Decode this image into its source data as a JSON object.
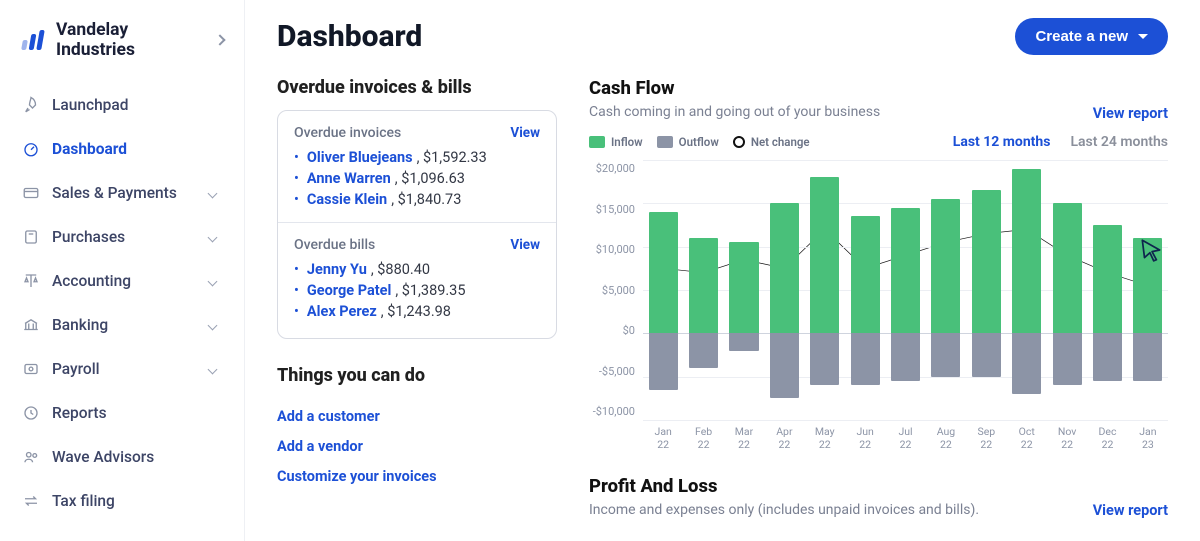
{
  "brand": {
    "name": "Vandelay Industries"
  },
  "sidebar": {
    "items": [
      {
        "icon": "rocket-icon",
        "label": "Launchpad",
        "active": false,
        "expandable": false
      },
      {
        "icon": "gauge-icon",
        "label": "Dashboard",
        "active": true,
        "expandable": false
      },
      {
        "icon": "card-icon",
        "label": "Sales & Payments",
        "active": false,
        "expandable": true
      },
      {
        "icon": "cart-icon",
        "label": "Purchases",
        "active": false,
        "expandable": true
      },
      {
        "icon": "scales-icon",
        "label": "Accounting",
        "active": false,
        "expandable": true
      },
      {
        "icon": "bank-icon",
        "label": "Banking",
        "active": false,
        "expandable": true
      },
      {
        "icon": "money-icon",
        "label": "Payroll",
        "active": false,
        "expandable": true
      },
      {
        "icon": "clock-icon",
        "label": "Reports",
        "active": false,
        "expandable": false
      },
      {
        "icon": "people-icon",
        "label": "Wave Advisors",
        "active": false,
        "expandable": false
      },
      {
        "icon": "arrows-icon",
        "label": "Tax filing",
        "active": false,
        "expandable": false
      }
    ]
  },
  "header": {
    "title": "Dashboard",
    "create_label": "Create a new"
  },
  "overdue": {
    "section_title": "Overdue invoices & bills",
    "invoices_heading": "Overdue invoices",
    "bills_heading": "Overdue bills",
    "view_label": "View",
    "invoices": [
      {
        "name": "Oliver Bluejeans",
        "amount": "$1,592.33"
      },
      {
        "name": "Anne Warren",
        "amount": "$1,096.63"
      },
      {
        "name": "Cassie Klein",
        "amount": "$1,840.73"
      }
    ],
    "bills": [
      {
        "name": "Jenny Yu",
        "amount": "$880.40"
      },
      {
        "name": "George Patel",
        "amount": "$1,389.35"
      },
      {
        "name": "Alex Perez",
        "amount": "$1,243.98"
      }
    ]
  },
  "things": {
    "title": "Things you can do",
    "links": [
      "Add a customer",
      "Add a vendor",
      "Customize your invoices"
    ]
  },
  "cashflow": {
    "title": "Cash Flow",
    "subtitle": "Cash coming in and going out of your business",
    "view_report": "View report",
    "legend": {
      "inflow": "Inflow",
      "outflow": "Outflow",
      "net": "Net change"
    },
    "range_active": "Last 12 months",
    "range_other": "Last 24 months"
  },
  "y_ticks": [
    "$20,000",
    "$15,000",
    "$10,000",
    "$5,000",
    "$0",
    "-$5,000",
    "-$10,000"
  ],
  "chart_data": {
    "type": "bar",
    "categories": [
      "Jan 22",
      "Feb 22",
      "Mar 22",
      "Apr 22",
      "May 22",
      "Jun 22",
      "Jul 22",
      "Aug 22",
      "Sep 22",
      "Oct 22",
      "Nov 22",
      "Dec 22",
      "Jan 23"
    ],
    "ylim": [
      -10000,
      20000
    ],
    "title": "Cash Flow",
    "xlabel": "",
    "ylabel": "",
    "series": [
      {
        "name": "Inflow",
        "values": [
          14000,
          11000,
          10500,
          15000,
          18000,
          13500,
          14500,
          15500,
          16500,
          19000,
          15000,
          12500,
          11000
        ]
      },
      {
        "name": "Outflow",
        "values": [
          -6500,
          -4000,
          -2000,
          -7500,
          -6000,
          -6000,
          -5500,
          -5000,
          -5000,
          -7000,
          -6000,
          -5500,
          -5500
        ]
      },
      {
        "name": "Net change",
        "values": [
          7500,
          7000,
          8500,
          7500,
          12000,
          7500,
          9000,
          10500,
          11500,
          12000,
          9000,
          7000,
          5500
        ]
      }
    ]
  },
  "pl": {
    "title": "Profit And Loss",
    "subtitle": "Income and expenses only (includes unpaid invoices and bills).",
    "view_report": "View report"
  }
}
